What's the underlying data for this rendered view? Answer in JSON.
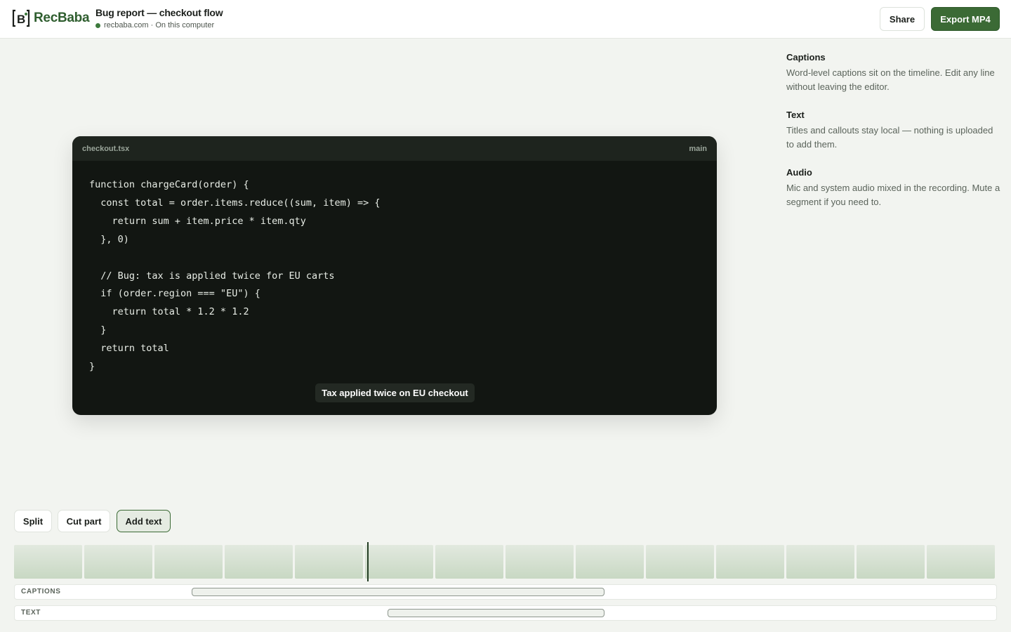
{
  "header": {
    "logo_text": "RecBaba",
    "doc_title": "Bug report — checkout flow",
    "doc_subtitle": "recbaba.com · On this computer",
    "share_label": "Share",
    "export_label": "Export MP4",
    "status_color": "#3d7a3d",
    "accent_color": "#3b6a35"
  },
  "preview": {
    "filename": "checkout.tsx",
    "branch": "main",
    "code_lines": [
      "function chargeCard(order) {",
      "  const total = order.items.reduce((sum, item) => {",
      "    return sum + item.price * item.qty",
      "  }, 0)",
      "",
      "  // Bug: tax is applied twice for EU carts",
      "  if (order.region === \"EU\") {",
      "    return total * 1.2 * 1.2",
      "  }",
      "  return total",
      "}"
    ],
    "caption_overlay": "Tax applied twice on EU checkout"
  },
  "side_panel": {
    "sections": [
      {
        "heading": "Captions",
        "body": "Word-level captions sit on the timeline. Edit any line without leaving the editor."
      },
      {
        "heading": "Text",
        "body": "Titles and callouts stay local — nothing is uploaded to add them."
      },
      {
        "heading": "Audio",
        "body": "Mic and system audio mixed in the recording. Mute a segment if you need to."
      }
    ]
  },
  "toolbar": {
    "split_label": "Split",
    "cut_label": "Cut part",
    "add_text_label": "Add text"
  },
  "timeline": {
    "captions_label": "CAPTIONS",
    "text_label": "TEXT",
    "frame_count": 14
  }
}
